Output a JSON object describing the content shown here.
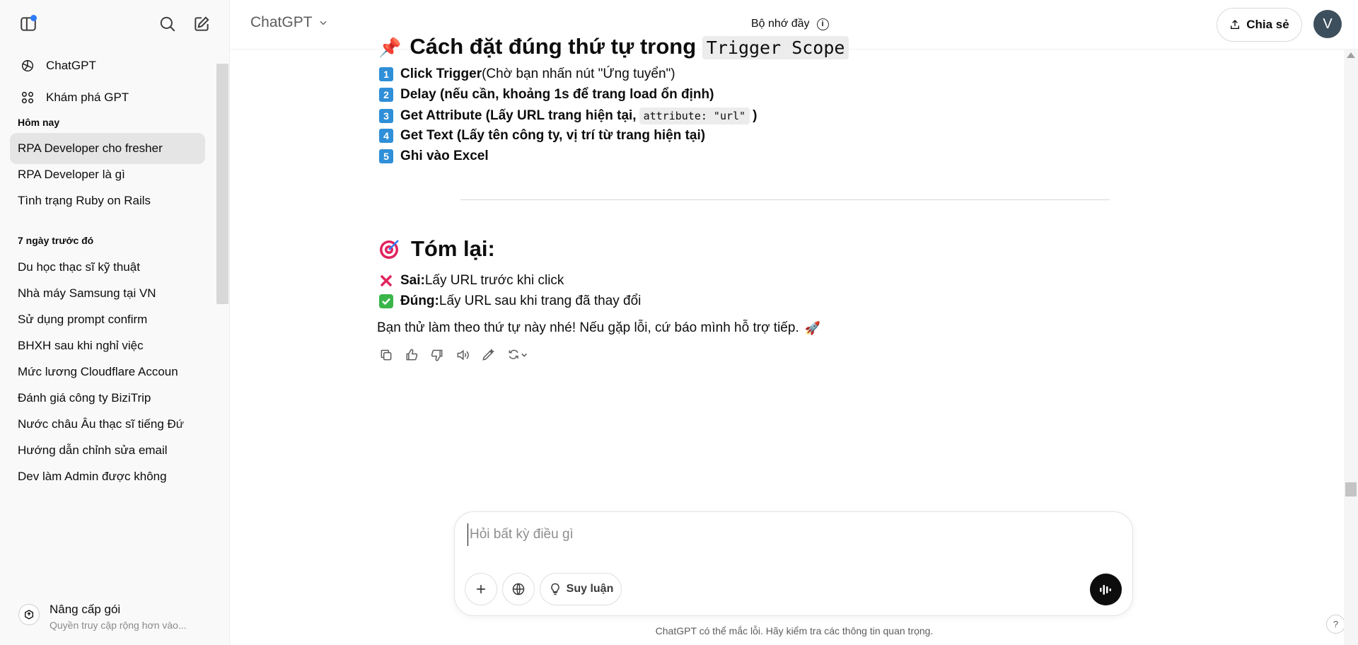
{
  "sidebar": {
    "nav": [
      {
        "label": "ChatGPT",
        "icon": "openai-logo-icon"
      },
      {
        "label": "Khám phá GPT",
        "icon": "grid-icon"
      }
    ],
    "sections": [
      {
        "title": "Hôm nay",
        "items": [
          "RPA Developer cho fresher",
          "RPA Developer là gì",
          "Tình trạng Ruby on Rails"
        ]
      },
      {
        "title": "7 ngày trước đó",
        "items": [
          "Du học thạc sĩ kỹ thuật",
          "Nhà máy Samsung tại VN",
          "Sử dụng prompt confirm",
          "BHXH sau khi nghỉ việc",
          "Mức lương Cloudflare Accoun",
          "Đánh giá công ty BiziTrip",
          "Nước châu Âu thạc sĩ tiếng Đứ",
          "Hướng dẫn chỉnh sửa email",
          "Dev làm Admin được không"
        ]
      }
    ],
    "active_item": "RPA Developer cho fresher",
    "upgrade": {
      "title": "Nâng cấp gói",
      "subtitle": "Quyền truy cập rộng hơn vào..."
    }
  },
  "header": {
    "model": "ChatGPT",
    "memory": "Bộ nhớ đầy",
    "share": "Chia sẻ",
    "avatar_letter": "V"
  },
  "message": {
    "partial_heading": {
      "text": "Cách đặt đúng thứ tự trong",
      "code": "Trigger Scope"
    },
    "steps": [
      {
        "num": "1",
        "bold": "Click Trigger",
        "rest": " (Chờ bạn nhấn nút \"Ứng tuyển\")"
      },
      {
        "num": "2",
        "bold": "Delay (nếu cần, khoảng 1s để trang load ổn định)",
        "rest": ""
      },
      {
        "num": "3",
        "bold": "Get Attribute (Lấy URL trang hiện tại,",
        "code": "attribute: \"url\"",
        "tail": ")"
      },
      {
        "num": "4",
        "bold": "Get Text (Lấy tên công ty, vị trí từ trang hiện tại)",
        "rest": ""
      },
      {
        "num": "5",
        "bold": "Ghi vào Excel",
        "rest": ""
      }
    ],
    "summary_heading": "Tóm lại:",
    "wrong": {
      "label": "Sai:",
      "text": " Lấy URL trước khi click"
    },
    "right": {
      "label": "Đúng:",
      "text": " Lấy URL sau khi trang đã thay đổi"
    },
    "closing": "Bạn thử làm theo thứ tự này nhé! Nếu gặp lỗi, cứ báo mình hỗ trợ tiếp."
  },
  "composer": {
    "placeholder": "Hỏi bất kỳ điều gì",
    "reason_label": "Suy luận"
  },
  "disclaimer": "ChatGPT có thể mắc lỗi. Hãy kiểm tra các thông tin quan trọng.",
  "help": "?",
  "colors": {
    "accent_dot": "#2f7bf6",
    "keycap": "#2f8fd8",
    "check": "#3ab54a",
    "cross": "#e0245e"
  }
}
